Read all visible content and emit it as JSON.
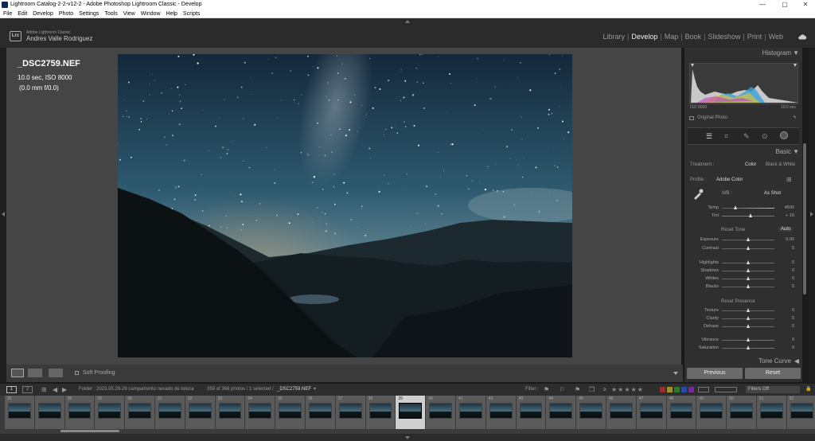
{
  "window": {
    "title": "Lightroom Catalog-2-2-v12-2 - Adobe Photoshop Lightroom Classic - Develop",
    "controls": [
      "—",
      "▢",
      "✕"
    ]
  },
  "menu": [
    "File",
    "Edit",
    "Develop",
    "Photo",
    "Settings",
    "Tools",
    "View",
    "Window",
    "Help",
    "Scripts"
  ],
  "identity": {
    "badge": "Lrc",
    "app_small": "Adobe Lightroom Classic",
    "user": "Andres Valle Rodriguez"
  },
  "modules": {
    "items": [
      "Library",
      "Develop",
      "Map",
      "Book",
      "Slideshow",
      "Print",
      "Web"
    ],
    "active": "Develop"
  },
  "photo_info": {
    "filename": "_DSC2759.NEF",
    "exposure": "10.0 sec, ISO 8000",
    "lens": "(0.0 mm f/0.0)"
  },
  "toolbar": {
    "soft_proofing": "Soft Proofing"
  },
  "histogram": {
    "title": "Histogram",
    "iso": "ISO 8000",
    "shutter": "10.0 sec",
    "original_photo": "Original Photo"
  },
  "basic": {
    "title": "Basic",
    "treatment_label": "Treatment :",
    "treatment_color": "Color",
    "treatment_bw": "Black & White",
    "profile_label": "Profile :",
    "profile_value": "Adobe Color",
    "wb_label": "WB :",
    "wb_value": "As Shot",
    "tone_label": "Reset Tone",
    "auto_label": "Auto",
    "presence_label": "Reset Presence",
    "sliders": [
      {
        "label": "Temp",
        "value": "4500",
        "fraction": 0.26
      },
      {
        "label": "Tint",
        "value": "+ 16",
        "fraction": 0.55
      },
      {
        "label": "Exposure",
        "value": "0.00",
        "fraction": 0.5
      },
      {
        "label": "Contrast",
        "value": "0",
        "fraction": 0.5
      },
      {
        "label": "Highlights",
        "value": "0",
        "fraction": 0.5
      },
      {
        "label": "Shadows",
        "value": "0",
        "fraction": 0.5
      },
      {
        "label": "Whites",
        "value": "0",
        "fraction": 0.5
      },
      {
        "label": "Blacks",
        "value": "0",
        "fraction": 0.5
      },
      {
        "label": "Texture",
        "value": "0",
        "fraction": 0.5
      },
      {
        "label": "Clarity",
        "value": "0",
        "fraction": 0.5
      },
      {
        "label": "Dehaze",
        "value": "0",
        "fraction": 0.5
      },
      {
        "label": "Vibrance",
        "value": "0",
        "fraction": 0.5
      },
      {
        "label": "Saturation",
        "value": "0",
        "fraction": 0.5
      }
    ]
  },
  "tone_curve": {
    "title": "Tone Curve"
  },
  "buttons": {
    "previous": "Previous",
    "reset": "Reset"
  },
  "filmstrip_bar": {
    "screen1": "1",
    "screen2": "2",
    "folder": "Folder : 2023.05.28-29 campamento nevado de toluca",
    "count": "359 of 366 photos / 1 selected /",
    "selected": "_DSC2759.NEF",
    "filter_label": "Filter :",
    "filters_off": "Filters Off"
  },
  "filmstrip": {
    "labels": [
      "25",
      "",
      "28",
      "29",
      "30",
      "31",
      "32",
      "33",
      "34",
      "35",
      "36",
      "37",
      "38",
      "39",
      "40",
      "41",
      "42",
      "43",
      "44",
      "45",
      "46",
      "47",
      "48",
      "49",
      "50",
      "51",
      "52"
    ],
    "selected_index": 13,
    "colors": {
      "frame": "#5a5a5a",
      "selected": "#cfcfcf"
    }
  },
  "colors": {
    "accent_active": "#eeeeee",
    "panel": "#2f2f2f",
    "canvas": "#454545"
  }
}
